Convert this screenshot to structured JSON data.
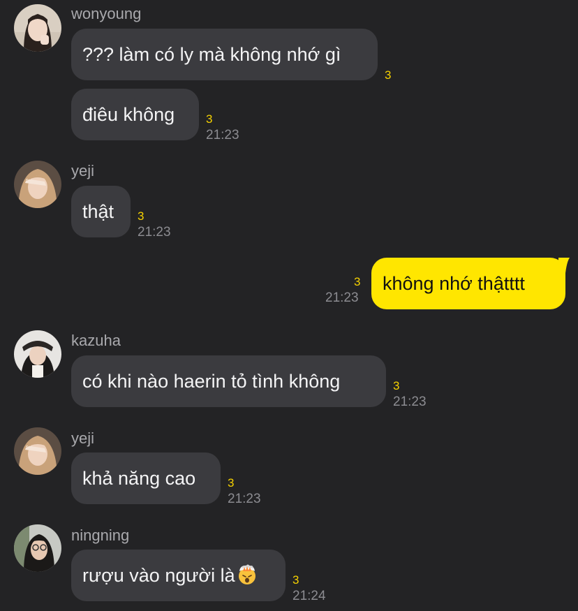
{
  "messages": [
    {
      "sender": "wonyoung",
      "lines": [
        "??? làm có ly mà không nhớ gì",
        "điêu không"
      ],
      "unread": [
        "3",
        "3"
      ],
      "time": "21:23"
    },
    {
      "sender": "yeji",
      "lines": [
        "thật"
      ],
      "unread": [
        "3"
      ],
      "time": "21:23"
    },
    {
      "sender": "me",
      "lines": [
        "không nhớ thậtttt"
      ],
      "unread": [
        "3"
      ],
      "time": "21:23"
    },
    {
      "sender": "kazuha",
      "lines": [
        "có khi nào haerin tỏ tình không"
      ],
      "unread": [
        "3"
      ],
      "time": "21:23"
    },
    {
      "sender": "yeji",
      "lines": [
        "khả năng cao"
      ],
      "unread": [
        "3"
      ],
      "time": "21:23"
    },
    {
      "sender": "ningning",
      "lines": [
        "rượu vào người là"
      ],
      "emoji": "exploding-head-icon",
      "unread": [
        "3"
      ],
      "time": "21:24"
    }
  ],
  "colors": {
    "background": "#232325",
    "bubble_other": "#3b3b3f",
    "bubble_mine": "#ffe600",
    "unread": "#f5d100",
    "timestamp": "#8c8c91"
  }
}
